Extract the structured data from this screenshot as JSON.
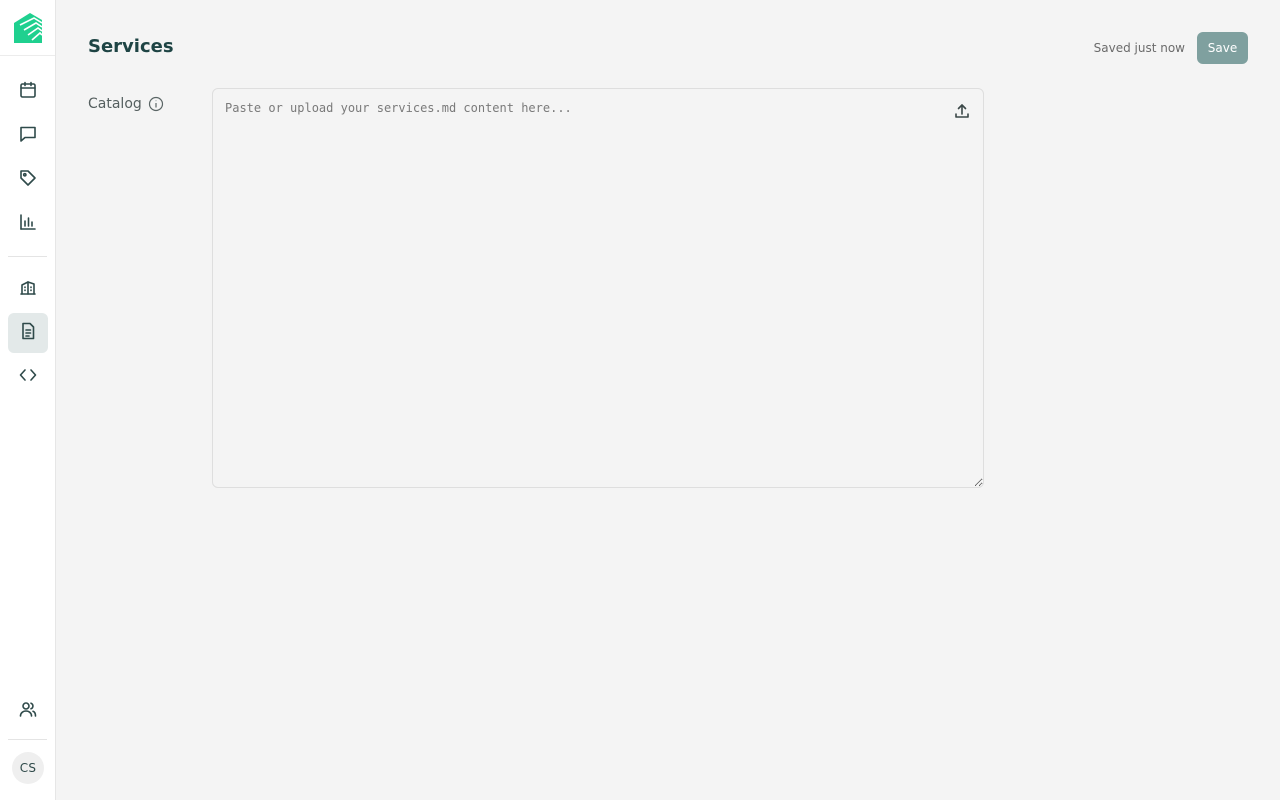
{
  "header": {
    "title": "Services",
    "save_status": "Saved just now",
    "save_label": "Save"
  },
  "form": {
    "catalog_label": "Catalog",
    "catalog_placeholder": "Paste or upload your services.md content here...",
    "catalog_value": ""
  },
  "sidebar": {
    "items": [
      {
        "name": "calendar-icon"
      },
      {
        "name": "chat-icon"
      },
      {
        "name": "tag-icon"
      },
      {
        "name": "bar-chart-icon"
      },
      {
        "name": "building-icon"
      },
      {
        "name": "document-icon",
        "active": true
      },
      {
        "name": "code-icon"
      },
      {
        "name": "users-icon"
      }
    ],
    "avatar_initials": "CS"
  },
  "colors": {
    "brand": "#18c08a",
    "accent": "#7fa09f",
    "active_bg": "#e3e9e9"
  }
}
